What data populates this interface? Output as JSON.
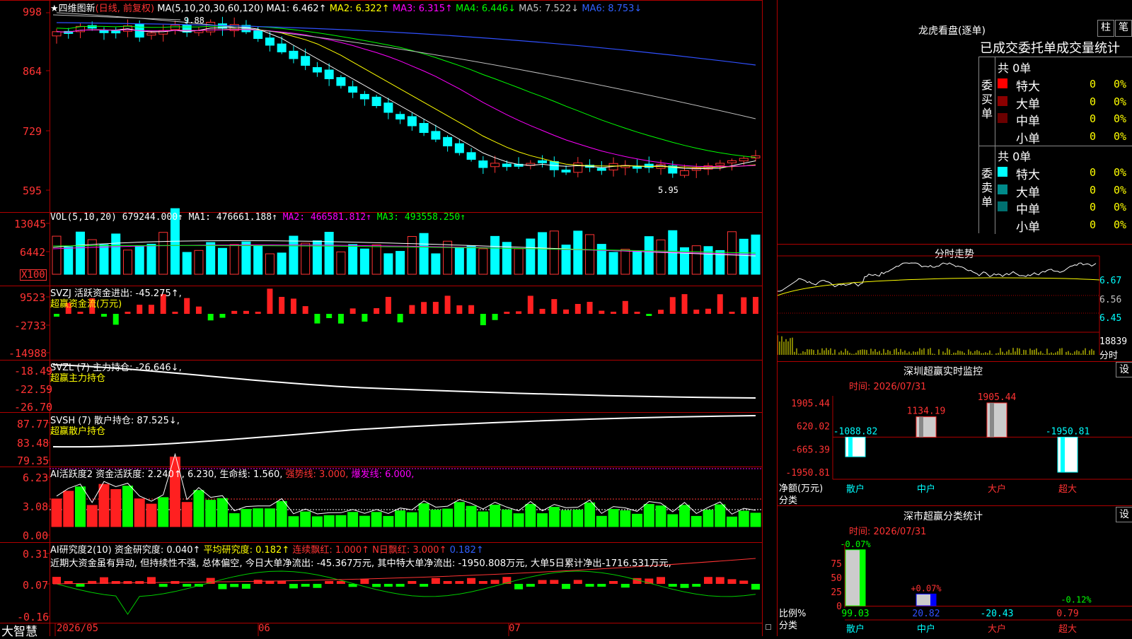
{
  "chart_panel": {
    "title_star": "★",
    "stock_name": "四维图新",
    "period": "(日线, 前复权)",
    "ma_label": "MA(5,10,20,30,60,120)",
    "ma1": "MA1: 6.462↑",
    "ma2": "MA2: 6.322↑",
    "ma3": "MA3: 6.315↑",
    "ma4": "MA4: 6.446↓",
    "ma5": "MA5: 7.522↓",
    "ma6": "MA6: 8.753↓",
    "high_mark": "9.88",
    "low_mark": "5.95",
    "y_ticks": [
      "998",
      "864",
      "729",
      "595"
    ],
    "colors": {
      "ma1": "#ffffff",
      "ma2": "#ffff00",
      "ma3": "#ff00ff",
      "ma4": "#00ff00",
      "ma5": "#c0c0c0",
      "ma6": "#0000ff",
      "up": "#ff3333",
      "down": "#00ffff"
    }
  },
  "vol_panel": {
    "label": "VOL(5,10,20)",
    "value": "679244.000↑",
    "ma1": "MA1: 476661.188↑",
    "ma2": "MA2: 466581.812↑",
    "ma3": "MA3: 493558.250↑",
    "y_ticks": [
      "13045",
      "6442"
    ],
    "unit": "X100"
  },
  "svzj_panel": {
    "label": "SVZJ",
    "value": "活跃资金进出: -45.275↑,",
    "sub": "超赢资金流(万元)",
    "y_ticks": [
      "9523",
      "-2733",
      "-14988"
    ]
  },
  "svzl_panel": {
    "label": "SVZL (7)",
    "value": "主力持仓: -26.646↓,",
    "sub": "超赢主力持仓",
    "y_ticks": [
      "-18.49",
      "-22.59",
      "-26.70"
    ]
  },
  "svsh_panel": {
    "label": "SVSH (7)",
    "value": "散户持仓: 87.525↓,",
    "sub": "超赢散户持仓",
    "y_ticks": [
      "87.77",
      "83.48",
      "79.35"
    ]
  },
  "ai_active_panel": {
    "label": "AI活跃度2",
    "value": "资金活跃度: 2.240↑",
    "v2": ", 6.230,",
    "v3": "生命线: 1.560,",
    "v4": "强势线: 3.000,",
    "v5": "爆发线: 6.000,",
    "y_ticks": [
      "6.23",
      "3.08",
      "0.00"
    ]
  },
  "ai_research_panel": {
    "label": "AI研究度2(10)",
    "value": "资金研究度: 0.040↑",
    "v2": "平均研究度: 0.182↑",
    "v3": "连续飘红: 1.000↑",
    "v4": "N日飘红: 3.000↑",
    "v5": "0.182↑",
    "comment": "近期大资金虽有异动, 但持续性不强, 总体偏空, 今日大单净流出: -45.367万元, 其中特大单净流出: -1950.808万元, 大单5日累计净出-1716.531万元,",
    "y_ticks": [
      "0.31",
      "0.07",
      "-0.16"
    ]
  },
  "bottom_axis": {
    "brand": "大智慧",
    "dates": [
      "2026/05",
      "06",
      "07"
    ]
  },
  "dragon_tiger": {
    "title": "龙虎看盘(逐单)",
    "btn_bar": "柱",
    "btn_pen": "笔",
    "header": "已成交委托单成交量统计",
    "buy_label": "委买单",
    "sell_label": "委卖单",
    "buy_total": "共 0单",
    "sell_total": "共 0单",
    "buy_rows": [
      {
        "name": "特大",
        "count": "0",
        "pct": "0%",
        "color": "#ff0000"
      },
      {
        "name": "大单",
        "count": "0",
        "pct": "0%",
        "color": "#8b0000"
      },
      {
        "name": "中单",
        "count": "0",
        "pct": "0%",
        "color": "#6b0000"
      },
      {
        "name": "小单",
        "count": "0",
        "pct": "0%",
        "color": "#000000"
      }
    ],
    "sell_rows": [
      {
        "name": "特大",
        "count": "0",
        "pct": "0%",
        "color": "#00ffff"
      },
      {
        "name": "大单",
        "count": "0",
        "pct": "0%",
        "color": "#008b8b"
      },
      {
        "name": "中单",
        "count": "0",
        "pct": "0%",
        "color": "#007070"
      },
      {
        "name": "小单",
        "count": "0",
        "pct": "0%",
        "color": "#000000"
      }
    ]
  },
  "intraday": {
    "title": "分时走势",
    "prices": [
      "6.67",
      "6.56",
      "6.45"
    ],
    "volume": "18839",
    "vol_label": "分时"
  },
  "sz_realtime": {
    "title": "深圳超赢实时监控",
    "btn": "设",
    "time": "时间: 2026/07/31",
    "y_ticks": [
      "1905.44",
      "620.02",
      "-665.39",
      "-1950.81"
    ],
    "y_label": "净额(万元)",
    "x_label": "分类",
    "categories": [
      "散户",
      "中户",
      "大户",
      "超大"
    ],
    "values": [
      -1088.82,
      1134.19,
      1905.44,
      -1950.81
    ],
    "value_labels": [
      "-1088.82",
      "1134.19",
      "1905.44",
      "-1950.81"
    ]
  },
  "sz_classify": {
    "title": "深市超赢分类统计",
    "btn": "设",
    "time": "时间: 2026/07/31",
    "y_ticks": [
      "75",
      "50",
      "25",
      "0"
    ],
    "y_label": "比例%",
    "x_label": "分类",
    "categories": [
      "散户",
      "中户",
      "大户",
      "超大"
    ],
    "top_labels": [
      "-0.07%",
      "+0.07%",
      "",
      "-0.12%"
    ],
    "bottom_values": [
      "99.03",
      "20.82",
      "-20.43",
      "0.79"
    ],
    "values": [
      99.03,
      20.82,
      -20.43,
      0.79
    ]
  }
}
